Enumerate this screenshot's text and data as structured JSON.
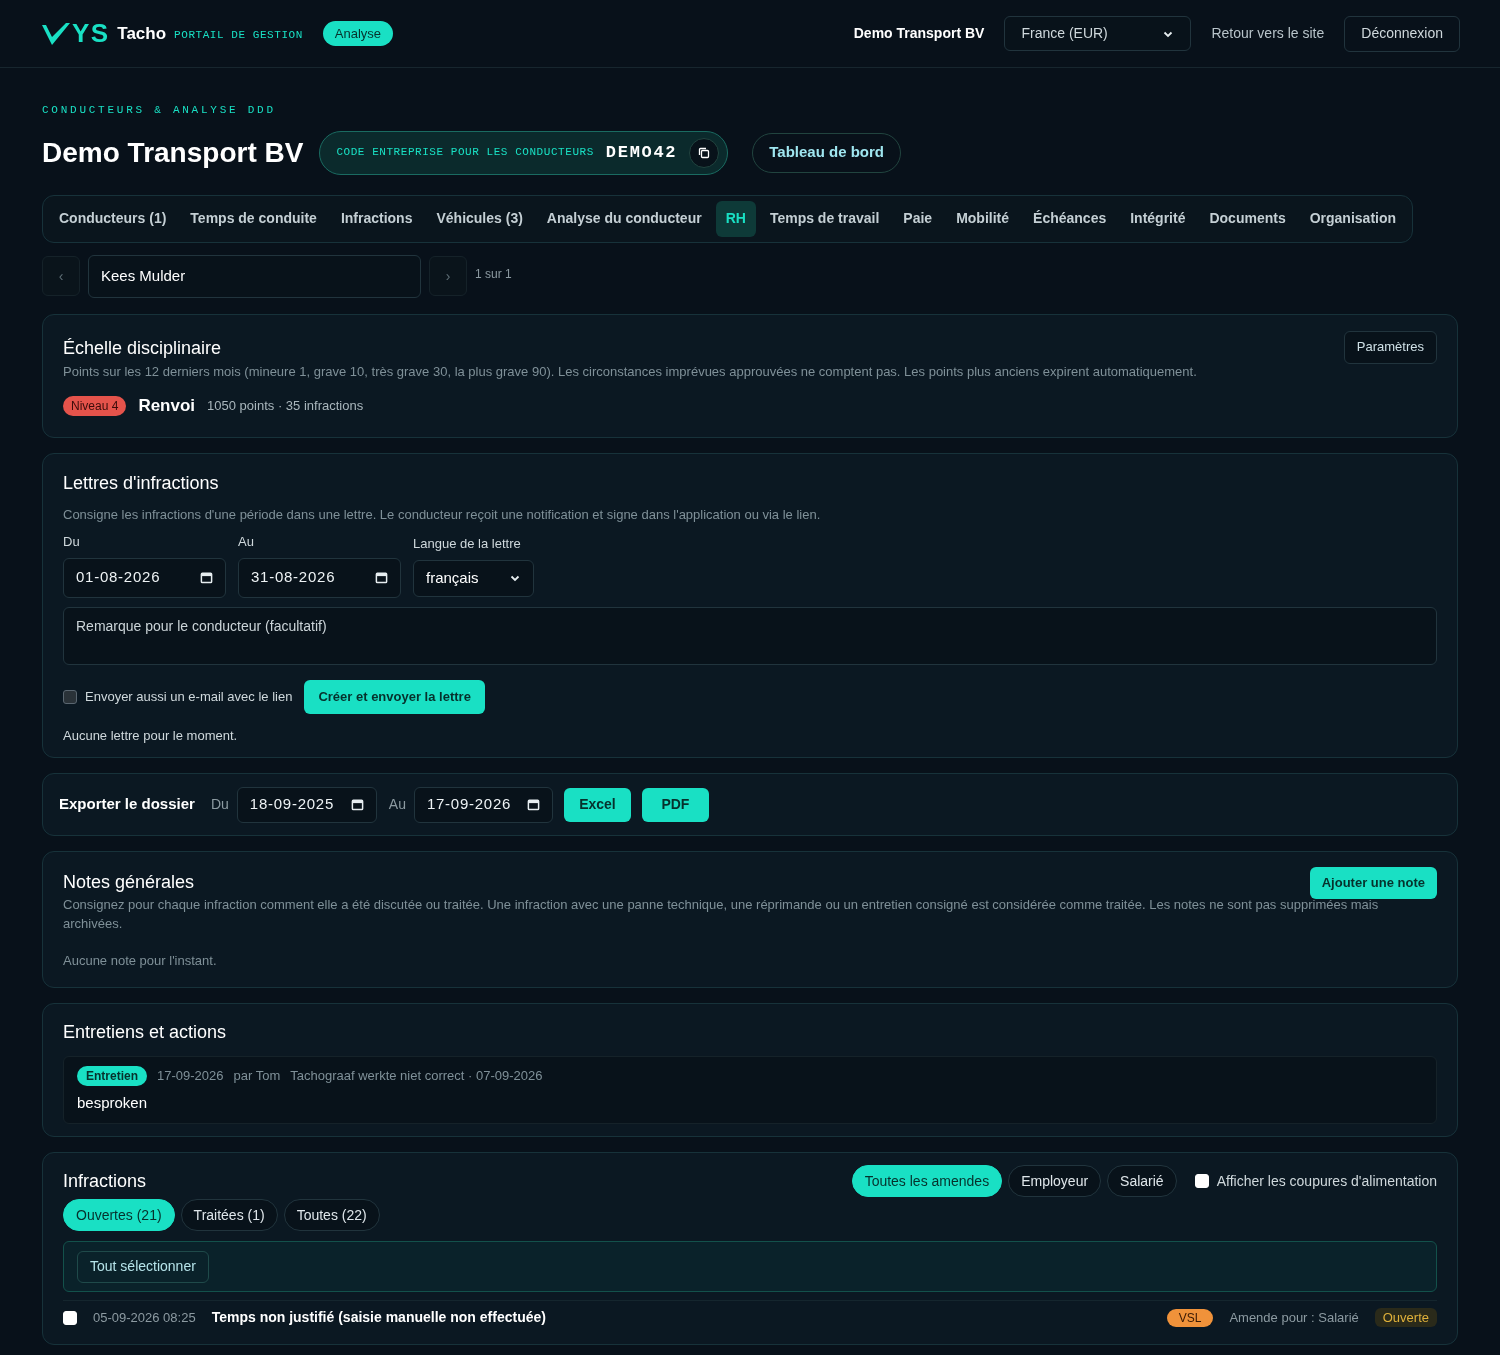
{
  "header": {
    "logo": "YS",
    "brand": "Tacho",
    "subtitle": "PORTAIL DE GESTION",
    "badge": "Analyse",
    "company": "Demo Transport BV",
    "currency": "France (EUR)",
    "back_link": "Retour vers le site",
    "logout": "Déconnexion"
  },
  "page": {
    "eyebrow": "CONDUCTEURS & ANALYSE DDD",
    "title": "Demo Transport BV",
    "code_label": "CODE ENTREPRISE POUR LES CONDUCTEURS",
    "code": "DEMO42",
    "dashboard": "Tableau de bord"
  },
  "tabs": [
    {
      "label": "Conducteurs (1)",
      "selected": false
    },
    {
      "label": "Temps de conduite",
      "selected": false
    },
    {
      "label": "Infractions",
      "selected": false
    },
    {
      "label": "Véhicules (3)",
      "selected": false
    },
    {
      "label": "Analyse du conducteur",
      "selected": false
    },
    {
      "label": "RH",
      "selected": true
    },
    {
      "label": "Temps de travail",
      "selected": false
    },
    {
      "label": "Paie",
      "selected": false
    },
    {
      "label": "Mobilité",
      "selected": false
    },
    {
      "label": "Échéances",
      "selected": false
    },
    {
      "label": "Intégrité",
      "selected": false
    },
    {
      "label": "Documents",
      "selected": false
    },
    {
      "label": "Organisation",
      "selected": false
    }
  ],
  "driver_nav": {
    "prev": "‹",
    "driver": "Kees Mulder",
    "next": "›",
    "count": "1 sur 1"
  },
  "discipline": {
    "title": "Échelle disciplinaire",
    "settings": "Paramètres",
    "description": "Points sur les 12 derniers mois (mineure 1, grave 10, très grave 30, la plus grave 90). Les circonstances imprévues approuvées ne comptent pas. Les points plus anciens expirent automatiquement.",
    "level": "Niveau 4",
    "verdict": "Renvoi",
    "summary": "1050 points · 35 infractions"
  },
  "letters": {
    "title": "Lettres d'infractions",
    "description": "Consigne les infractions d'une période dans une lettre. Le conducteur reçoit une notification et signe dans l'application ou via le lien.",
    "from_label": "Du",
    "from": "01-08-2026",
    "to_label": "Au",
    "to": "31-08-2026",
    "language_label": "Langue de la lettre",
    "language": "français",
    "remark_placeholder": "Remarque pour le conducteur (facultatif)",
    "email_label": "Envoyer aussi un e-mail avec le lien",
    "email_checked": false,
    "submit": "Créer et envoyer la lettre",
    "empty": "Aucune lettre pour le moment."
  },
  "export": {
    "title": "Exporter le dossier",
    "from_label": "Du",
    "from": "18-09-2025",
    "to_label": "Au",
    "to": "17-09-2026",
    "buttons": [
      "Excel",
      "PDF"
    ]
  },
  "notes": {
    "title": "Notes générales",
    "add": "Ajouter une note",
    "description": "Consignez pour chaque infraction comment elle a été discutée ou traitée. Une infraction avec une panne technique, une réprimande ou un entretien consigné est considérée comme traitée. Les notes ne sont pas supprimées mais archivées.",
    "empty": "Aucune note pour l'instant."
  },
  "interviews": {
    "title": "Entretiens et actions",
    "entries": [
      {
        "tag": "Entretien",
        "date": "17-09-2026",
        "author": "par Tom",
        "subject": "Tachograaf werkte niet correct · 07-09-2026",
        "text": "besproken"
      }
    ]
  },
  "infractions": {
    "title": "Infractions",
    "fine_filters": [
      {
        "label": "Toutes les amendes",
        "selected": true
      },
      {
        "label": "Employeur",
        "selected": false
      },
      {
        "label": "Salarié",
        "selected": false
      }
    ],
    "power_cuts": {
      "label": "Afficher les coupures d'alimentation",
      "checked": false
    },
    "status_tabs": [
      {
        "label": "Ouvertes (21)",
        "selected": true
      },
      {
        "label": "Traitées (1)",
        "selected": false
      },
      {
        "label": "Toutes (22)",
        "selected": false
      }
    ],
    "select_all": "Tout sélectionner",
    "rows": [
      {
        "checked": false,
        "datetime": "05-09-2026 08:25",
        "title": "Temps non justifié (saisie manuelle non effectuée)",
        "tag": "VSL",
        "fine": "Amende pour : Salarié",
        "status": "Ouverte"
      }
    ]
  }
}
